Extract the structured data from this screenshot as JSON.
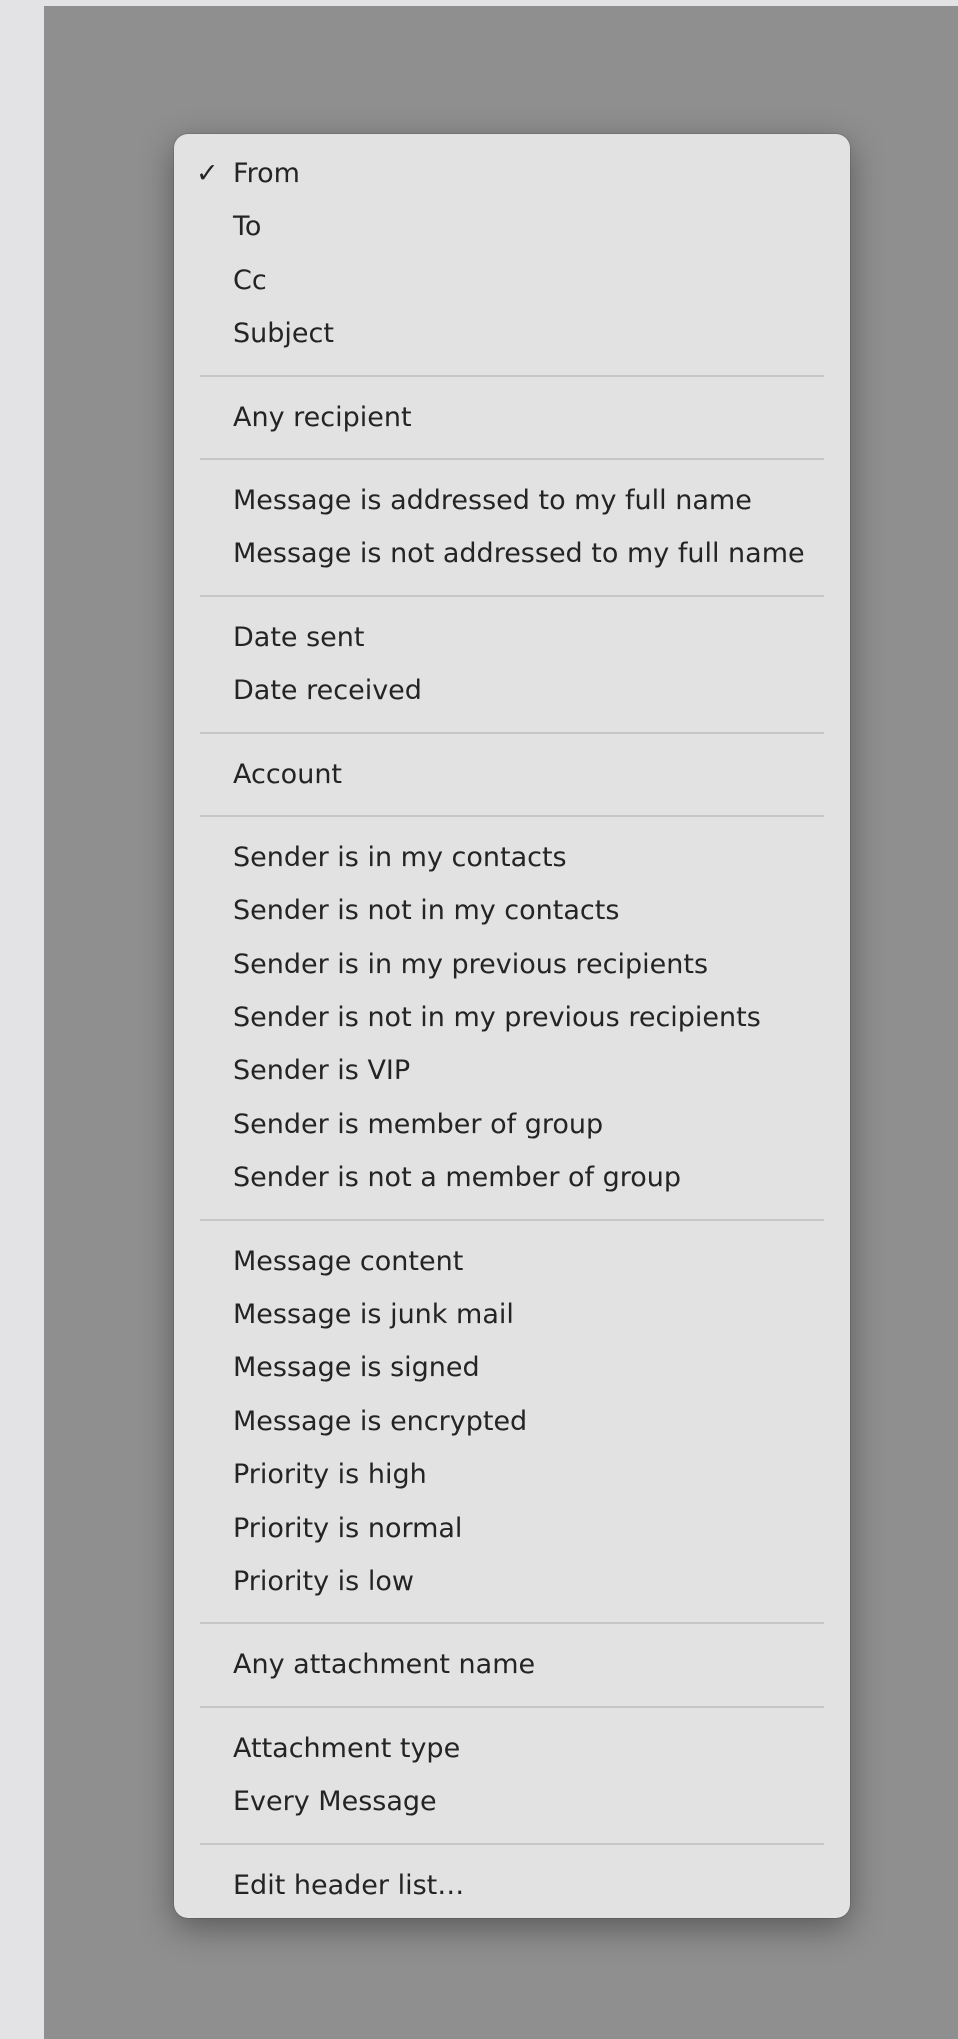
{
  "menu": {
    "check_glyph": "✓",
    "groups": [
      [
        "From",
        "To",
        "Cc",
        "Subject"
      ],
      [
        "Any recipient"
      ],
      [
        "Message is addressed to my full name",
        "Message is not addressed to my full name"
      ],
      [
        "Date sent",
        "Date received"
      ],
      [
        "Account"
      ],
      [
        "Sender is in my contacts",
        "Sender is not in my contacts",
        "Sender is in my previous recipients",
        "Sender is not in my previous recipients",
        "Sender is VIP",
        "Sender is member of group",
        "Sender is not a member of group"
      ],
      [
        "Message content",
        "Message is junk mail",
        "Message is signed",
        "Message is encrypted",
        "Priority is high",
        "Priority is normal",
        "Priority is low"
      ],
      [
        "Any attachment name"
      ],
      [
        "Attachment type",
        "Every Message"
      ],
      [
        "Edit header list…"
      ]
    ]
  }
}
